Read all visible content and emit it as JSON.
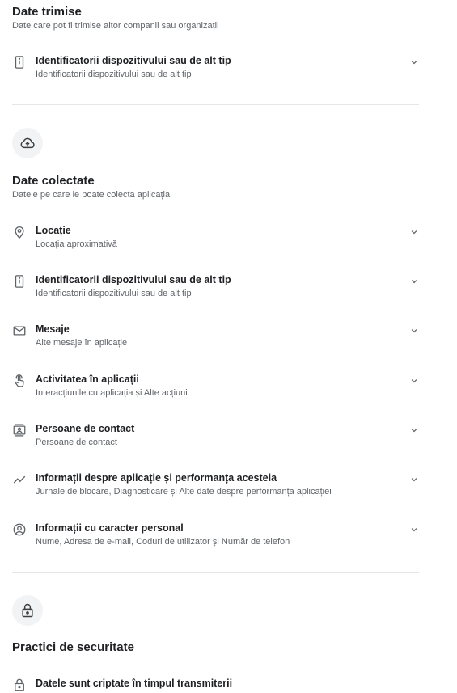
{
  "shared": {
    "title": "Date trimise",
    "subtitle": "Date care pot fi trimise altor companii sau organizații",
    "items": [
      {
        "icon": "device-id-icon",
        "title": "Identificatorii dispozitivului sau de alt tip",
        "subtitle": "Identificatorii dispozitivului sau de alt tip"
      }
    ]
  },
  "collected": {
    "badge_icon": "cloud-upload-icon",
    "title": "Date colectate",
    "subtitle": "Datele pe care le poate colecta aplicația",
    "items": [
      {
        "icon": "location-pin-icon",
        "title": "Locație",
        "subtitle": "Locația aproximativă"
      },
      {
        "icon": "device-id-icon",
        "title": "Identificatorii dispozitivului sau de alt tip",
        "subtitle": "Identificatorii dispozitivului sau de alt tip"
      },
      {
        "icon": "mail-icon",
        "title": "Mesaje",
        "subtitle": "Alte mesaje în aplicație"
      },
      {
        "icon": "touch-icon",
        "title": "Activitatea în aplicații",
        "subtitle": "Interacțiunile cu aplicația și Alte acțiuni"
      },
      {
        "icon": "contacts-icon",
        "title": "Persoane de contact",
        "subtitle": "Persoane de contact"
      },
      {
        "icon": "trending-icon",
        "title": "Informații despre aplicație și performanța acesteia",
        "subtitle": "Jurnale de blocare, Diagnosticare și Alte date despre performanța aplicației"
      },
      {
        "icon": "account-circle-icon",
        "title": "Informații cu caracter personal",
        "subtitle": "Nume, Adresa de e-mail, Coduri de utilizator și Număr de telefon"
      }
    ]
  },
  "security": {
    "badge_icon": "lock-icon",
    "title": "Practici de securitate",
    "items": [
      {
        "icon": "lock-icon",
        "title": "Datele sunt criptate în timpul transmiterii"
      }
    ]
  },
  "colors": {
    "text": "#202124",
    "secondary_text": "#5f6368",
    "badge_bg": "#f1f3f4",
    "divider": "#e6e6e6"
  }
}
